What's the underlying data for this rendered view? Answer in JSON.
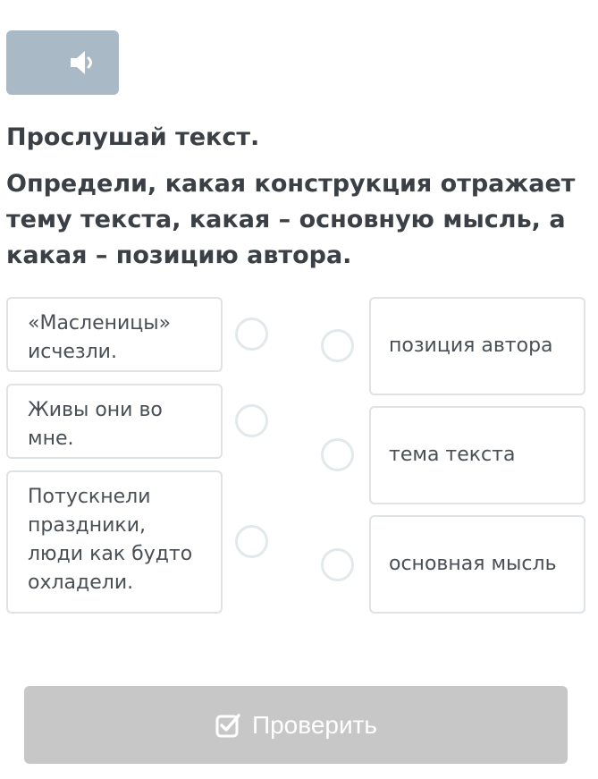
{
  "audio": {
    "icon": "speaker-icon",
    "bg_color": "#a9b9c5"
  },
  "instructions": {
    "title": "Прослушай текст.",
    "question": "Определи, какая конструкция отражает тему текста, какая – основную мысль, а какая – позицию автора."
  },
  "left_items": [
    {
      "text": "«Масленицы» исчезли."
    },
    {
      "text": "Живы они во мне."
    },
    {
      "text": "Потускнели праздники, люди как будто охладели."
    }
  ],
  "right_items": [
    {
      "text": "позиция автора"
    },
    {
      "text": "тема текста"
    },
    {
      "text": "основная мысль"
    }
  ],
  "check_button": {
    "label": "Проверить",
    "icon": "check-square-icon",
    "bg_color": "#c7c7c7"
  }
}
